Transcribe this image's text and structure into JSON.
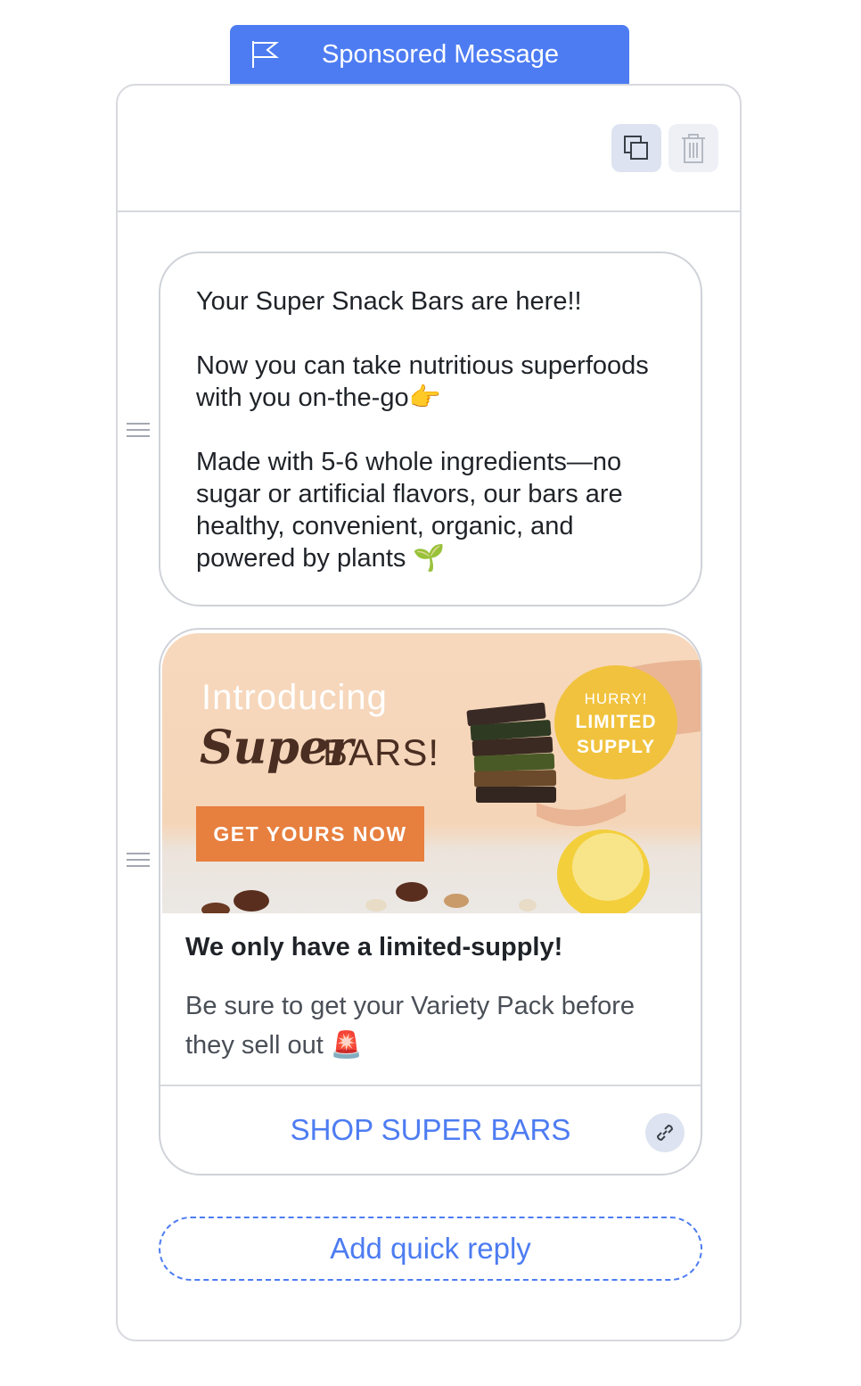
{
  "header": {
    "tab_label": "Sponsored Message",
    "flag_icon": "flag-icon"
  },
  "toolbar": {
    "copy_icon": "copy-icon",
    "delete_icon": "trash-icon"
  },
  "text_message": {
    "line1": "Your Super Snack Bars are here!!",
    "line2": "Now you can take nutritious superfoods with you on-the-go👉",
    "line3": "Made with 5-6 whole ingredients—no sugar or artificial flavors, our bars are healthy, convenient, organic, and powered by plants 🌱"
  },
  "card": {
    "image": {
      "heading_intro": "Introducing",
      "heading_super": "Super",
      "heading_bars": "BARS!",
      "cta": "GET YOURS NOW",
      "badge_line1": "HURRY!",
      "badge_line2": "LIMITED",
      "badge_line3": "SUPPLY"
    },
    "title": "We only have a limited-supply!",
    "subtitle": "Be sure to get your Variety Pack before they sell out 🚨",
    "button_label": "SHOP SUPER BARS",
    "button_icon": "link-icon"
  },
  "quick_reply": {
    "label": "Add quick reply"
  },
  "colors": {
    "accent": "#4d7cf2",
    "border": "#d7d9de",
    "cta_orange": "#e77f3e",
    "badge_yellow": "#f1c23d"
  }
}
